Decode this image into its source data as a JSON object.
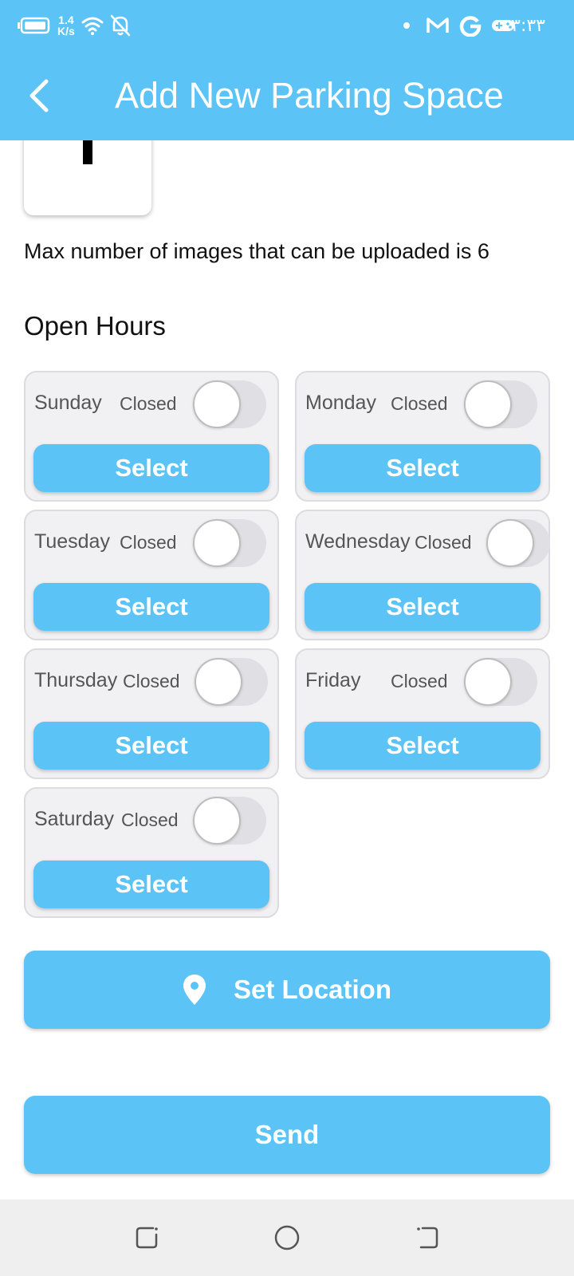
{
  "status_bar": {
    "net_speed_value": "1.4",
    "net_speed_unit": "K/s",
    "time": "٣:٣٣",
    "icons": [
      "battery-icon",
      "wifi-icon",
      "notifications-off-icon",
      "dot-icon",
      "gmail-icon",
      "google-icon",
      "game-controller-icon"
    ]
  },
  "app_bar": {
    "title": "Add New Parking Space",
    "back_icon": "chevron-left-icon"
  },
  "images": {
    "add_icon": "plus-icon",
    "max_note": "Max number of images that can be uploaded is 6"
  },
  "open_hours": {
    "title": "Open Hours",
    "days": [
      {
        "name": "Sunday",
        "status": "Closed",
        "enabled": false,
        "button": "Select"
      },
      {
        "name": "Monday",
        "status": "Closed",
        "enabled": false,
        "button": "Select"
      },
      {
        "name": "Tuesday",
        "status": "Closed",
        "enabled": false,
        "button": "Select"
      },
      {
        "name": "Wednesday",
        "status": "Closed",
        "enabled": false,
        "button": "Select"
      },
      {
        "name": "Thursday",
        "status": "Closed",
        "enabled": false,
        "button": "Select"
      },
      {
        "name": "Friday",
        "status": "Closed",
        "enabled": false,
        "button": "Select"
      },
      {
        "name": "Saturday",
        "status": "Closed",
        "enabled": false,
        "button": "Select"
      }
    ]
  },
  "actions": {
    "set_location": "Set Location",
    "location_icon": "location-pin-icon",
    "send": "Send"
  },
  "colors": {
    "primary": "#5bc3f5",
    "card_background": "#f1f1f4",
    "nav_bar": "#efefef"
  },
  "nav_bar": {
    "icons": [
      "recent-apps-icon",
      "home-icon",
      "back-icon"
    ]
  }
}
